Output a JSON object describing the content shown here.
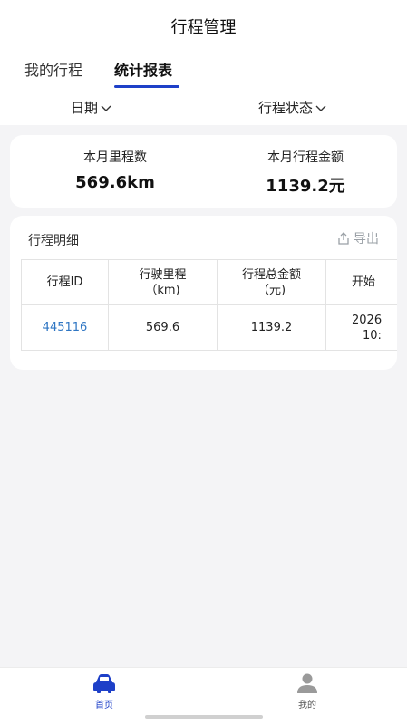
{
  "header": {
    "title": "行程管理"
  },
  "tabs": [
    {
      "label": "我的行程"
    },
    {
      "label": "统计报表"
    }
  ],
  "filters": {
    "date_label": "日期",
    "status_label": "行程状态"
  },
  "summary": {
    "mileage_label": "本月里程数",
    "mileage_value": "569.6km",
    "amount_label": "本月行程金额",
    "amount_value": "1139.2元"
  },
  "detail": {
    "title": "行程明细",
    "export_label": "导出",
    "columns": [
      {
        "line1": "行程ID",
        "line2": ""
      },
      {
        "line1": "行驶里程",
        "line2": "（km)"
      },
      {
        "line1": "行程总金额",
        "line2": "（元)"
      },
      {
        "line1": "开始",
        "line2": ""
      }
    ],
    "rows": [
      {
        "id": "445116",
        "mileage": "569.6",
        "amount": "1139.2",
        "start_line1": "2026",
        "start_line2": "10:"
      }
    ]
  },
  "bottom_nav": [
    {
      "label": "首页",
      "icon": "car-icon",
      "color": "#1e40c8"
    },
    {
      "label": "我的",
      "icon": "person-icon",
      "color": "#9a9a9a"
    }
  ],
  "colors": {
    "accent": "#1e40c8",
    "link": "#2f76c3",
    "background": "#f4f4f6"
  }
}
